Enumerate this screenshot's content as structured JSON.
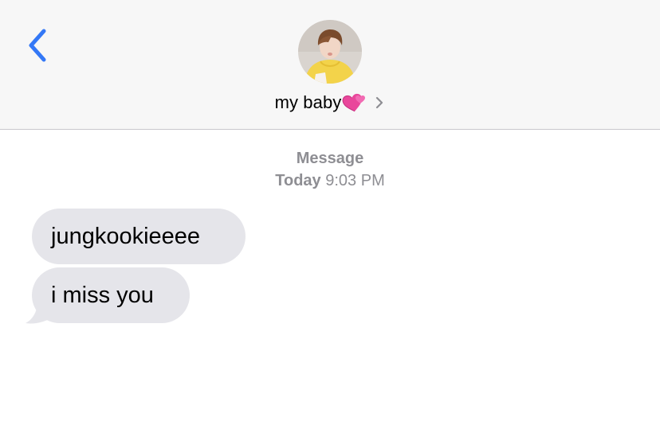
{
  "header": {
    "back_icon": "chevron-left-icon",
    "contact_name": "my baby",
    "name_emoji": "💞",
    "detail_icon": "chevron-right-icon"
  },
  "thread": {
    "service_label": "Message",
    "day": "Today",
    "time": "9:03 PM"
  },
  "messages": [
    {
      "direction": "incoming",
      "text": "jungkookieeee"
    },
    {
      "direction": "incoming",
      "text": "i miss you"
    }
  ],
  "colors": {
    "accent": "#3478f6",
    "incoming_bubble": "#e5e5ea",
    "header_bg": "#f7f7f7",
    "meta_text": "#8e8e93"
  }
}
